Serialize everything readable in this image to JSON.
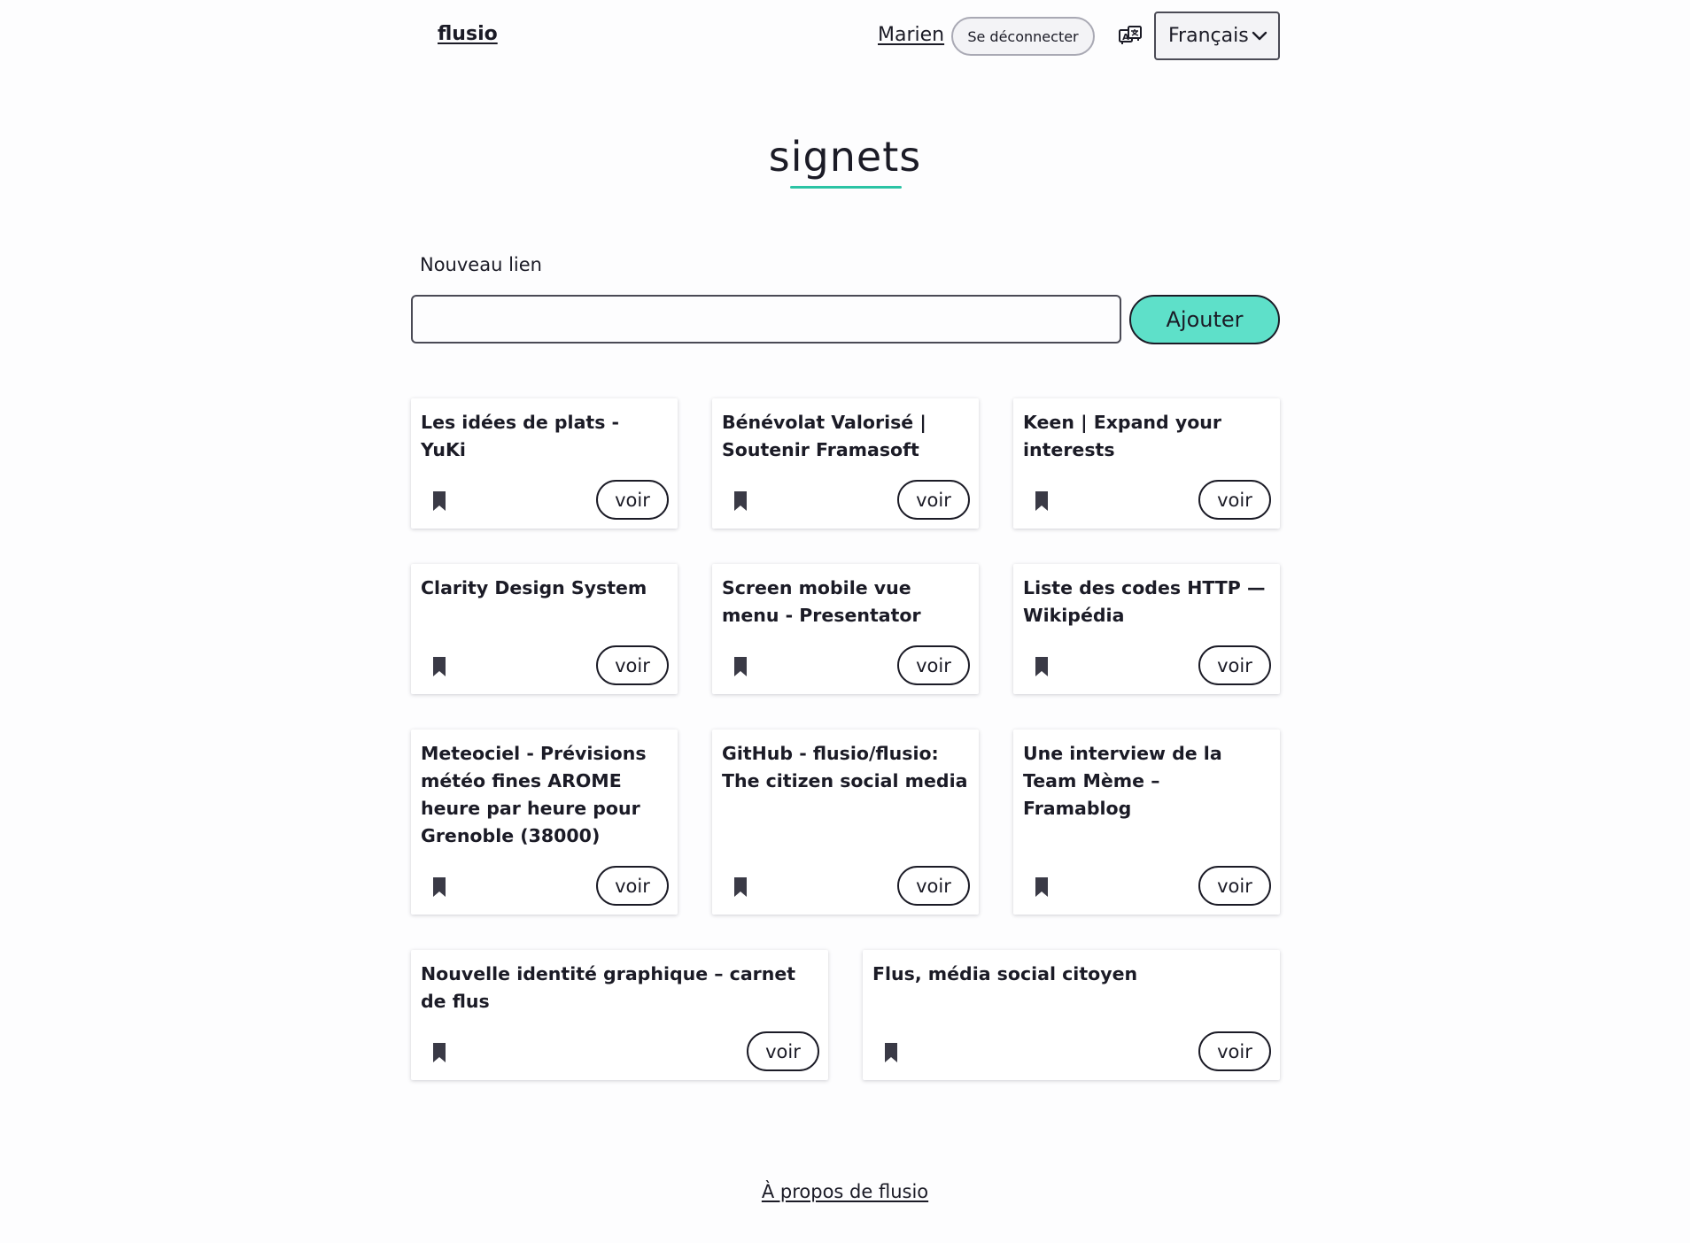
{
  "header": {
    "logo": "flusio",
    "user_name": "Marien",
    "logout_label": "Se déconnecter",
    "language_icon": "translate-icon",
    "language_selected": "Français"
  },
  "page": {
    "title": "signets",
    "accent_color": "#2bc3a4"
  },
  "new_link": {
    "label": "Nouveau lien",
    "input_value": "",
    "placeholder": "",
    "submit_label": "Ajouter",
    "button_color": "#5ee0c9"
  },
  "links": [
    {
      "title": "Les idées de plats - YuKi",
      "action": "voir",
      "icon": "bookmark-icon"
    },
    {
      "title": "Bénévolat Valorisé | Soutenir Framasoft",
      "action": "voir",
      "icon": "bookmark-icon"
    },
    {
      "title": "Keen | Expand your interests",
      "action": "voir",
      "icon": "bookmark-icon"
    },
    {
      "title": "Clarity Design System",
      "action": "voir",
      "icon": "bookmark-icon"
    },
    {
      "title": "Screen mobile vue menu - Presentator",
      "action": "voir",
      "icon": "bookmark-icon"
    },
    {
      "title": "Liste des codes HTTP — Wikipédia",
      "action": "voir",
      "icon": "bookmark-icon"
    },
    {
      "title": "Meteociel - Prévisions météo fines AROME heure par heure pour Grenoble (38000)",
      "action": "voir",
      "icon": "bookmark-icon"
    },
    {
      "title": "GitHub - flusio/flusio: The citizen social media",
      "action": "voir",
      "icon": "bookmark-icon"
    },
    {
      "title": "Une interview de la Team Mème – Framablog",
      "action": "voir",
      "icon": "bookmark-icon"
    },
    {
      "title": "Nouvelle identité graphique – carnet de flus",
      "action": "voir",
      "icon": "bookmark-icon"
    },
    {
      "title": "Flus, média social citoyen",
      "action": "voir",
      "icon": "bookmark-icon"
    }
  ],
  "footer": {
    "about_label": "À propos de flusio"
  }
}
